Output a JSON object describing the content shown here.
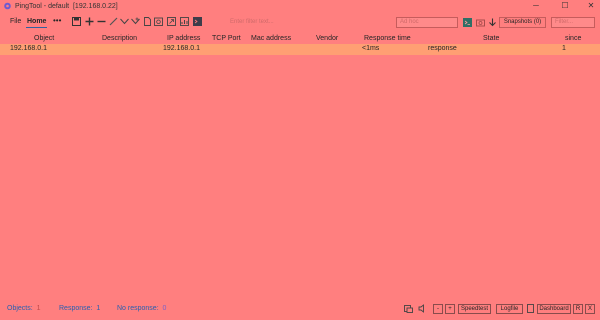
{
  "window": {
    "app_name": "PingTool - default",
    "host": "[192.168.0.22]",
    "minimize": "─",
    "maximize": "☐",
    "close": "✕"
  },
  "menu": {
    "file": "File",
    "home": "Home",
    "more": "•••"
  },
  "toolbar": {
    "icons": [
      "save-icon",
      "add-icon",
      "remove-icon",
      "edit-icon",
      "tag-icon",
      "tag-add-icon",
      "page-icon",
      "clock-icon",
      "export-icon",
      "chart-icon",
      "terminal-icon"
    ],
    "filter_hint": "Enter filter text...",
    "ad_hoc_placeholder": "Ad hoc",
    "snapshots_label": "Snapshots (0)",
    "filter_placeholder": "Filter..."
  },
  "table": {
    "columns": [
      "Object",
      "Description",
      "IP address",
      "TCP Port",
      "Mac address",
      "Vendor",
      "Response time",
      "State",
      "since"
    ],
    "rows": [
      {
        "object": "192.168.0.1",
        "description": "",
        "ip_address": "192.168.0.1",
        "tcp_port": "",
        "mac_address": "",
        "vendor": "",
        "response_time": "<1ms",
        "state": "response",
        "since": "1"
      }
    ]
  },
  "status_bar": {
    "objects_label": "Objects:",
    "objects_value": "1",
    "response_label": "Response:",
    "response_value": "1",
    "no_response_label": "No response:",
    "no_response_value": "0",
    "minus": "-",
    "plus": "+",
    "speedtest": "Speedtest",
    "logfile": "Logfile",
    "dashboard": "Dashboard",
    "r": "R",
    "x": "X"
  },
  "colors": {
    "background": "#ff7f7f",
    "row_highlight": "#ff9f73",
    "status_text": "#2a5fb0",
    "no_response_value": "#7b61c9"
  }
}
